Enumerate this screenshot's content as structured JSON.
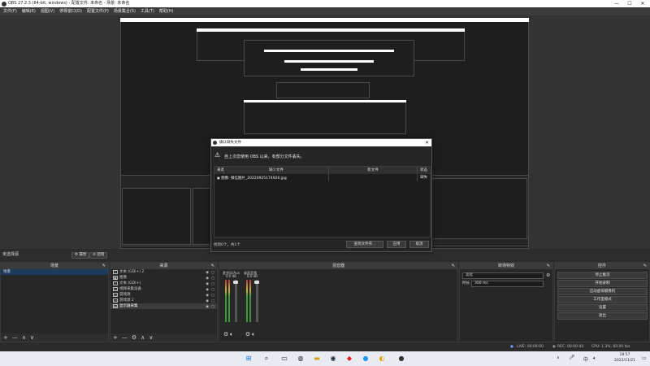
{
  "window": {
    "title": "OBS 27.2.3 (64-bit, windows) - 配置文件: 未命名 - 场景: 未命名",
    "minimize": "—",
    "maximize": "☐",
    "close": "✕"
  },
  "menu": [
    "文件(F)",
    "编辑(E)",
    "视图(V)",
    "停靠窗口(D)",
    "配置文件(P)",
    "场景集合(S)",
    "工具(T)",
    "帮助(H)"
  ],
  "scenebar": {
    "label": "未选择源",
    "properties": "属性",
    "filters": "滤镜"
  },
  "docks": {
    "scenes": {
      "title": "场景",
      "items": [
        "场景"
      ],
      "footer": [
        "+",
        "—",
        "∧",
        "∨"
      ]
    },
    "sources": {
      "title": "来源",
      "items": [
        {
          "icon": "T",
          "label": "文本 (GDI+) 2"
        },
        {
          "icon": "▣",
          "label": "图像"
        },
        {
          "icon": "T",
          "label": "文本 (GDI+)"
        },
        {
          "icon": "▭",
          "label": "视频采集设备"
        },
        {
          "icon": "▭",
          "label": "游戏源"
        },
        {
          "icon": "▭",
          "label": "游戏源 2"
        },
        {
          "icon": "▭",
          "label": "显示器采集"
        }
      ],
      "footer": [
        "+",
        "—",
        "⚙",
        "∧",
        "∨"
      ]
    },
    "mixer": {
      "title": "混音器",
      "channels": [
        {
          "name": "麦克风/Aux",
          "db": "0.0 dB"
        },
        {
          "name": "桌面音频",
          "db": "0.0 dB"
        }
      ]
    },
    "transitions": {
      "title": "转场特效",
      "type": "淡化",
      "duration_label": "时长",
      "duration": "300 ms"
    },
    "controls": {
      "title": "控件",
      "buttons": [
        "停止推流",
        "开始录制",
        "启动虚拟摄像机",
        "工作室模式",
        "设置",
        "退出"
      ]
    }
  },
  "status": {
    "live": "LIVE: 00:00:00",
    "rec": "REC: 00:00:00",
    "cpu": "CPU: 1.3%, 60.00 fps"
  },
  "dialog": {
    "title": "确认缺失文件",
    "message": "自上次您使用 OBS 以来，有部分文件丢失。",
    "columns": [
      "来源",
      "缺少文件",
      "新文件",
      "状态"
    ],
    "rows": [
      {
        "source": "图像",
        "missing": "微信图片_20220925174920.jpg",
        "new": "",
        "status": "缺失"
      }
    ],
    "footer": "找到0个，共1个",
    "buttons": [
      "查找文件夹...",
      "应用",
      "取消"
    ]
  },
  "taskbar": {
    "time": "18:57",
    "date": "2022/11/21",
    "lang": "中"
  },
  "colors": {
    "accent": "#1d3a5c",
    "bg": "#2b2b2b",
    "dock": "#272727"
  }
}
